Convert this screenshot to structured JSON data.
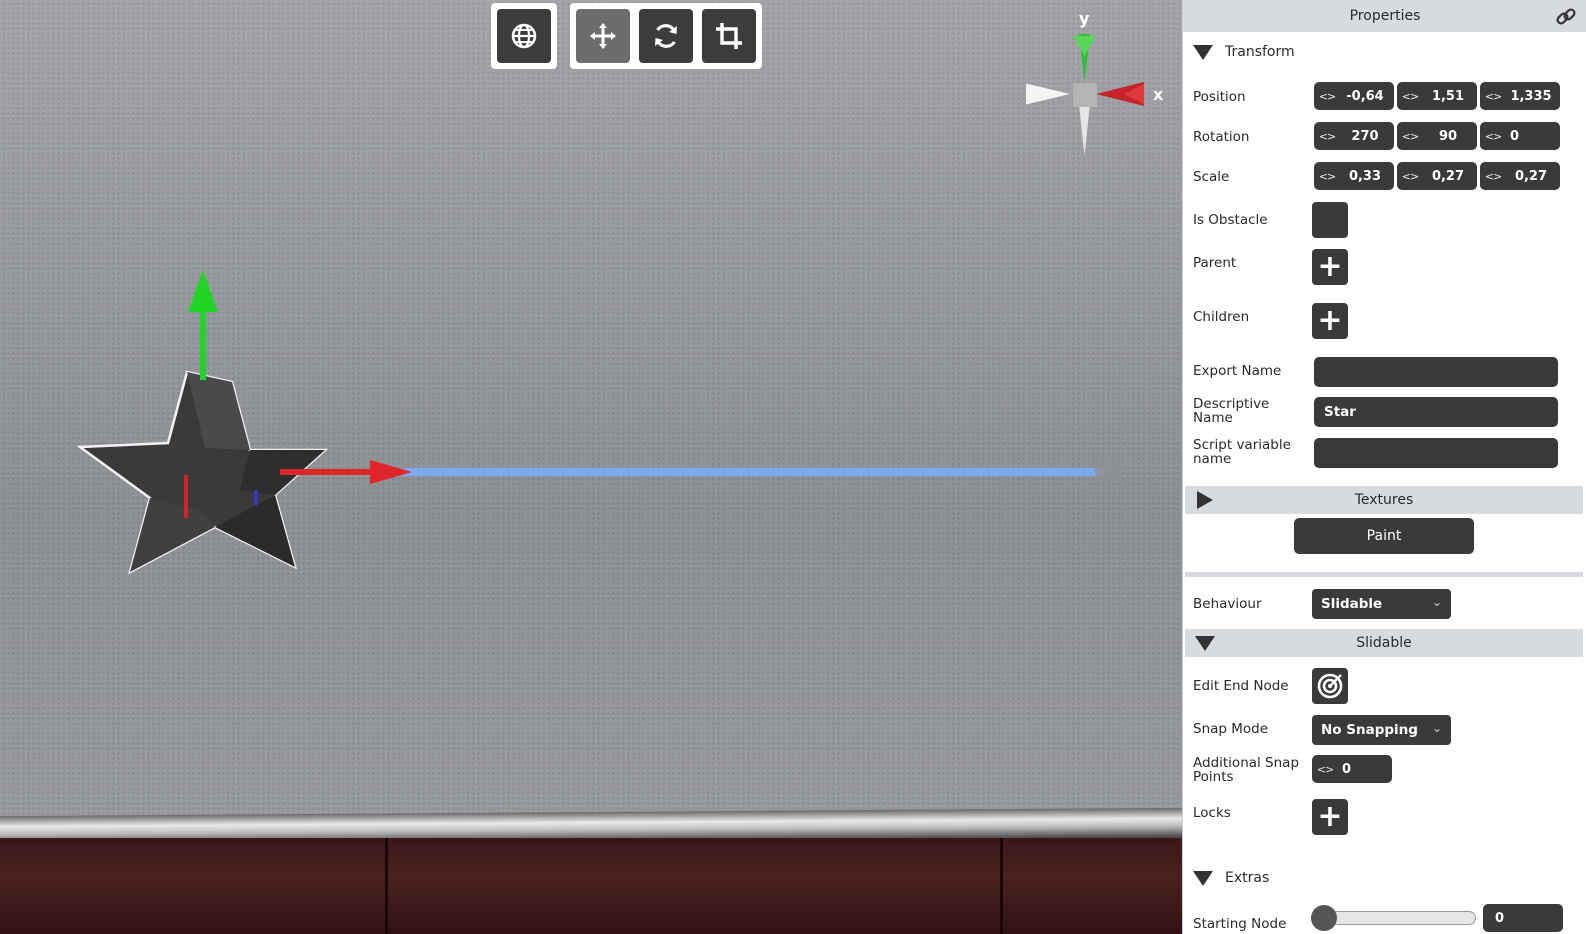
{
  "toolbar": {
    "world_icon": "globe-icon",
    "tools": [
      {
        "name": "move-tool",
        "icon": "move-arrows-icon",
        "active": true
      },
      {
        "name": "rotate-tool",
        "icon": "rotate-icon",
        "active": false
      },
      {
        "name": "scale-tool",
        "icon": "crop-icon",
        "active": false
      }
    ]
  },
  "gizmo": {
    "x_label": "x",
    "y_label": "y"
  },
  "panel": {
    "title": "Properties",
    "link_icon": "link-icon",
    "transform": {
      "title": "Transform",
      "position_label": "Position",
      "position": [
        "-0,64",
        "1,51",
        "1,335"
      ],
      "rotation_label": "Rotation",
      "rotation": [
        "270",
        "90",
        "0"
      ],
      "scale_label": "Scale",
      "scale": [
        "0,33",
        "0,27",
        "0,27"
      ],
      "is_obstacle_label": "Is Obstacle",
      "parent_label": "Parent",
      "children_label": "Children",
      "export_name_label": "Export Name",
      "export_name": "",
      "descriptive_name_label": "Descriptive Name",
      "descriptive_name": "Star",
      "script_variable_label": "Script variable name",
      "script_variable": ""
    },
    "textures": {
      "title": "Textures",
      "paint_label": "Paint"
    },
    "behaviour": {
      "label": "Behaviour",
      "value": "Slidable"
    },
    "slidable": {
      "title": "Slidable",
      "edit_end_node_label": "Edit End Node",
      "snap_mode_label": "Snap Mode",
      "snap_mode": "No Snapping",
      "additional_snap_label": "Additional Snap Points",
      "additional_snap": "0",
      "locks_label": "Locks"
    },
    "extras": {
      "title": "Extras",
      "starting_node_label": "Starting Node",
      "starting_node": "0",
      "starting_node_slider": 0
    }
  },
  "colors": {
    "accent_dark": "#3a3a3a",
    "header_bg": "#d7dbe0",
    "axis_x": "#e0262b",
    "axis_y": "#2ecc2e",
    "slide_path": "#7aaaf0"
  }
}
